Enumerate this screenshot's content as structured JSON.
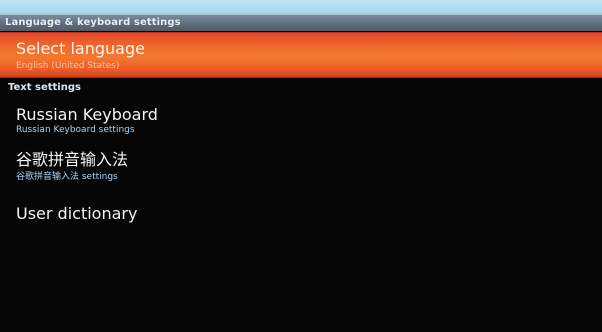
{
  "window": {
    "title": "Language & keyboard settings"
  },
  "select_language": {
    "title": "Select language",
    "summary": "English (United States)"
  },
  "text_settings": {
    "header": "Text settings",
    "items": [
      {
        "title": "Russian Keyboard",
        "summary": "Russian Keyboard settings"
      },
      {
        "title": "谷歌拼音输入法",
        "summary": "谷歌拼音输入法 settings"
      },
      {
        "title": "User dictionary"
      }
    ]
  },
  "colors": {
    "selected_highlight": "#f3792e",
    "summary_text": "#a9d3ee",
    "background": "#060606"
  }
}
